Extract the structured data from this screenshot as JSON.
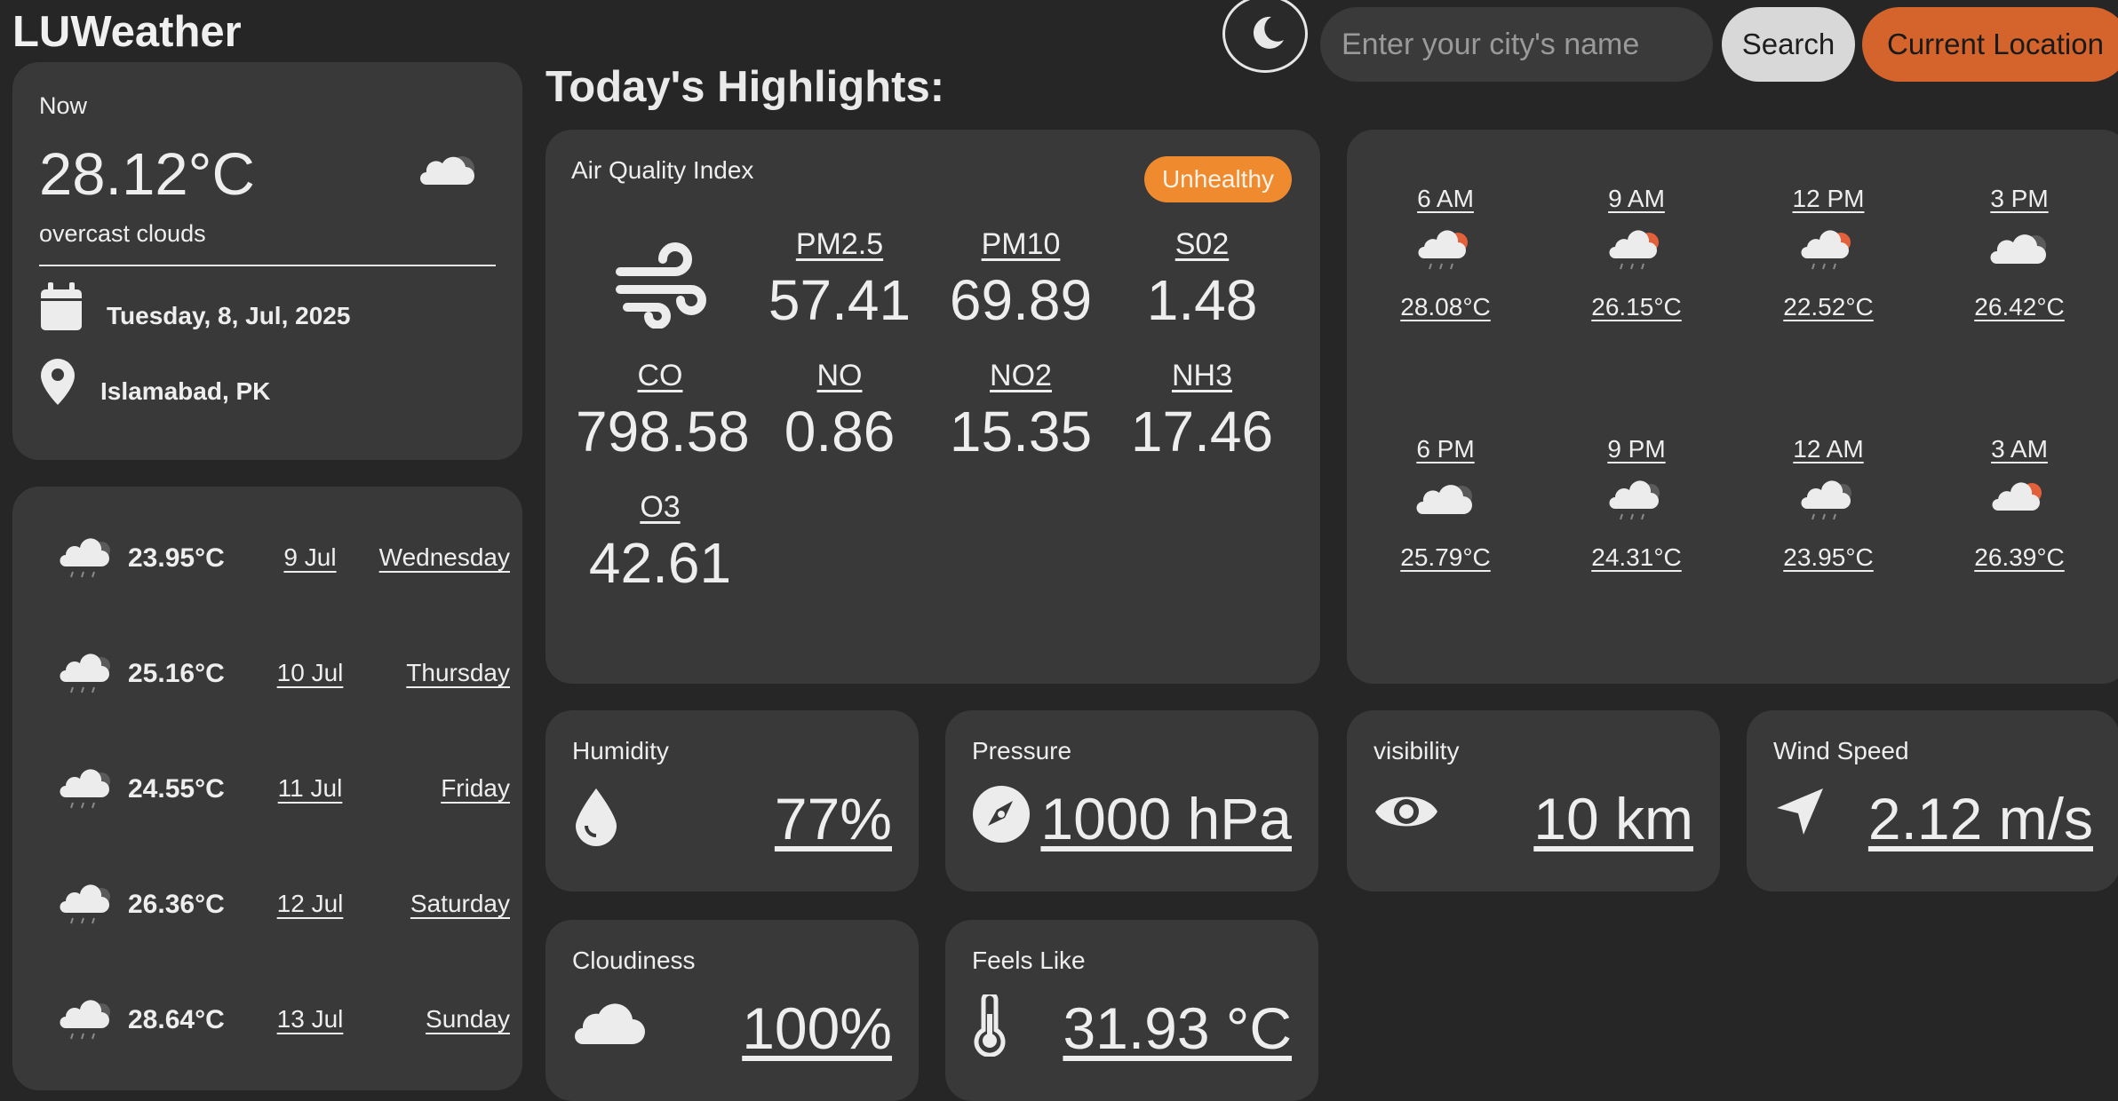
{
  "app": {
    "title": "LUWeather"
  },
  "header": {
    "search_placeholder": "Enter your city's name",
    "search_label": "Search",
    "location_label": "Current Location",
    "theme_icon": "moon-icon"
  },
  "now": {
    "label": "Now",
    "temp": "28.12°C",
    "desc": "overcast clouds",
    "date": "Tuesday, 8, Jul, 2025",
    "place": "Islamabad, PK"
  },
  "forecast": [
    {
      "temp": "23.95°C",
      "date": "9 Jul",
      "day": "Wednesday"
    },
    {
      "temp": "25.16°C",
      "date": "10 Jul",
      "day": "Thursday"
    },
    {
      "temp": "24.55°C",
      "date": "11 Jul",
      "day": "Friday"
    },
    {
      "temp": "26.36°C",
      "date": "12 Jul",
      "day": "Saturday"
    },
    {
      "temp": "28.64°C",
      "date": "13 Jul",
      "day": "Sunday"
    }
  ],
  "highlights": {
    "title": "Today's Highlights:",
    "aqi": {
      "title": "Air Quality Index",
      "badge": "Unhealthy",
      "badge_color": "#f08a2e",
      "items": [
        {
          "name": "PM2.5",
          "value": "57.41"
        },
        {
          "name": "PM10",
          "value": "69.89"
        },
        {
          "name": "S02",
          "value": "1.48"
        },
        {
          "name": "CO",
          "value": "798.58"
        },
        {
          "name": "NO",
          "value": "0.86"
        },
        {
          "name": "NO2",
          "value": "15.35"
        },
        {
          "name": "NH3",
          "value": "17.46"
        },
        {
          "name": "O3",
          "value": "42.61"
        }
      ]
    },
    "hourly": [
      {
        "time": "6 AM",
        "temp": "28.08°C",
        "icon": "sun-cloud-rain-icon"
      },
      {
        "time": "9 AM",
        "temp": "26.15°C",
        "icon": "sun-cloud-rain-icon"
      },
      {
        "time": "12 PM",
        "temp": "22.52°C",
        "icon": "sun-cloud-rain-icon"
      },
      {
        "time": "3 PM",
        "temp": "26.42°C",
        "icon": "cloud-icon"
      },
      {
        "time": "6 PM",
        "temp": "25.79°C",
        "icon": "cloud-icon"
      },
      {
        "time": "9 PM",
        "temp": "24.31°C",
        "icon": "cloud-rain-icon"
      },
      {
        "time": "12 AM",
        "temp": "23.95°C",
        "icon": "cloud-rain-icon"
      },
      {
        "time": "3 AM",
        "temp": "26.39°C",
        "icon": "sun-cloud-icon"
      }
    ],
    "metrics": {
      "humidity": {
        "label": "Humidity",
        "value": "77%"
      },
      "pressure": {
        "label": "Pressure",
        "value": "1000 hPa"
      },
      "visibility": {
        "label": "visibility",
        "value": "10 km"
      },
      "wind": {
        "label": "Wind Speed",
        "value": "2.12 m/s"
      },
      "cloudiness": {
        "label": "Cloudiness",
        "value": "100%"
      },
      "feels_like": {
        "label": "Feels Like",
        "value": "31.93 °C"
      }
    }
  }
}
